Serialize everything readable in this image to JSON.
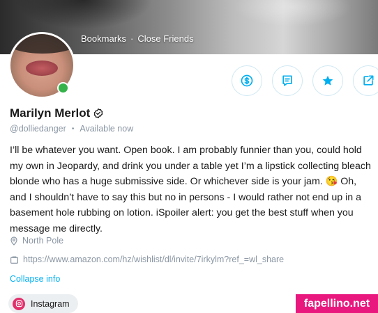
{
  "cover": {
    "nav": [
      {
        "label": "Bookmarks"
      },
      {
        "label": "Close Friends"
      }
    ]
  },
  "profile": {
    "name": "Marilyn Merlot",
    "handle": "@dolliedanger",
    "status": "Available now",
    "bio": "I’ll be whatever you want. Open book. I am probably funnier than you, could hold my own in Jeopardy, and drink you under a table yet I’m a lipstick collecting bleach blonde who has a huge submissive side. Or whichever side is your jam. 😘 Oh, and I shouldn’t have to say this but no in persons - I would rather not end up in a basement hole rubbing on lotion. iSpoiler alert: you get the best stuff when you message me directly.",
    "location": "North Pole",
    "link": "https://www.amazon.com/hz/wishlist/dl/invite/7irkylm?ref_=wl_share",
    "collapse_label": "Collapse info",
    "social": [
      {
        "label": "Instagram"
      }
    ]
  },
  "actions": [
    {
      "icon": "dollar-icon"
    },
    {
      "icon": "message-icon"
    },
    {
      "icon": "star-icon"
    },
    {
      "icon": "share-icon"
    }
  ],
  "watermark": "fapellino.net",
  "colors": {
    "accent": "#00aff0",
    "online": "#35b24a",
    "muted": "#8a96a3",
    "watermark": "#e8187e"
  }
}
